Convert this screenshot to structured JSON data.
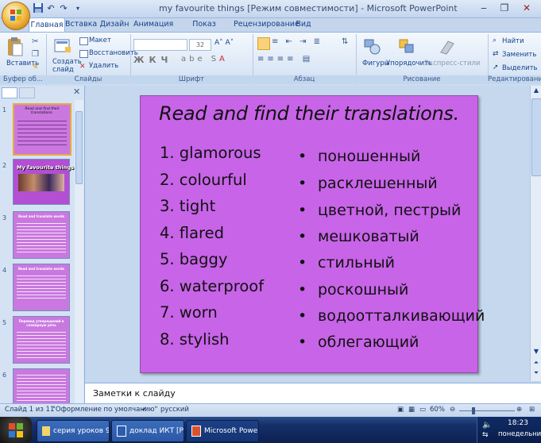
{
  "window": {
    "title": "my favourite things [Режим совместимости] - Microsoft PowerPoint",
    "minimize": "‒",
    "restore": "❐",
    "close": "✕"
  },
  "quick_access": [
    "save-icon",
    "undo-icon",
    "redo-icon"
  ],
  "tabs": [
    {
      "label": "Главная",
      "active": true
    },
    {
      "label": "Вставка"
    },
    {
      "label": "Дизайн"
    },
    {
      "label": "Анимация"
    },
    {
      "label": "Показ слайдов"
    },
    {
      "label": "Рецензирование"
    },
    {
      "label": "Вид"
    }
  ],
  "ribbon": {
    "clipboard": {
      "paste": "Вставить",
      "label": "Буфер об..."
    },
    "slides": {
      "create": "Создать слайд",
      "layout": "Макет",
      "reset": "Восстановить",
      "delete": "Удалить",
      "label": "Слайды"
    },
    "font": {
      "size": "32",
      "label": "Шрифт"
    },
    "paragraph": {
      "label": "Абзац"
    },
    "drawing": {
      "shapes": "Фигуры",
      "arrange": "Упорядочить",
      "quick_styles": "Экспресс-стили",
      "label": "Рисование"
    },
    "editing": {
      "find": "Найти",
      "replace": "Заменить",
      "select": "Выделить",
      "label": "Редактирование"
    }
  },
  "slide": {
    "title": "Read and find their translations.",
    "english": [
      "1. glamorous",
      "2. colourful",
      "3. tight",
      "4. flared",
      "5. baggy",
      "6. waterproof",
      "7. worn",
      "8. stylish"
    ],
    "russian": [
      "поношенный",
      "расклешенный",
      "цветной, пестрый",
      "мешковатый",
      "стильный",
      "роскошный",
      "водоотталкивающий",
      "облегающий"
    ],
    "bullet": "•"
  },
  "thumbnails": {
    "numbers": [
      "1",
      "2",
      "3",
      "4",
      "5",
      "6"
    ],
    "slide1_title": "Read and find their translations.",
    "slide2_title": "My favourite things",
    "slide3_title": "Read and translate words",
    "slide4_title": "Read and translate words",
    "slide5_title": "Перевод утверждений в словарную речь",
    "colors": {
      "slide_bg": "#c864e8",
      "thumb_bg": "#ca78e0"
    }
  },
  "notes": {
    "placeholder": "Заметки к слайду"
  },
  "status": {
    "slide": "Слайд 1 из 11",
    "theme": "\"Оформление по умолчанию\"",
    "language": "русский",
    "zoom": "60%"
  },
  "taskbar": {
    "items": [
      {
        "label": "серия уроков 9..."
      },
      {
        "label": "доклад ИКТ [Ре..."
      },
      {
        "label": "Microsoft Power...",
        "active": true
      }
    ],
    "time": "18:23",
    "day": "понедельник"
  }
}
